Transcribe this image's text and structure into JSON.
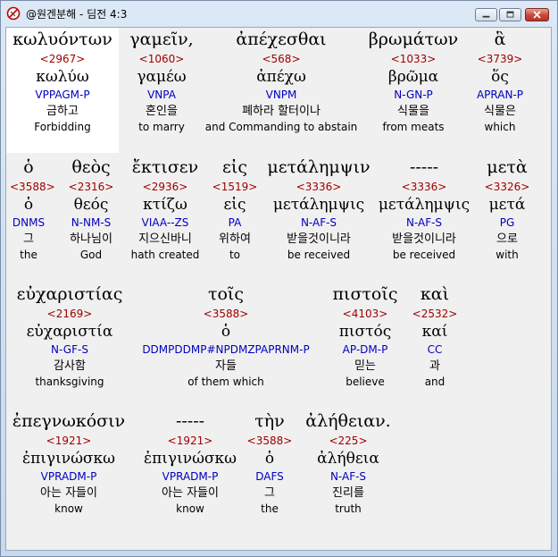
{
  "window": {
    "title": "@원겐분해 - 딤전 4:3",
    "minimize_label": "minimize",
    "maximize_label": "maximize",
    "close_label": "close"
  },
  "rows": [
    [
      {
        "word": "κωλυόντων",
        "strongs": "<2967>",
        "lemma": "κωλύω",
        "parse": "VPPAGM-P",
        "korean": "금하고",
        "english": "Forbidding",
        "selected": true
      },
      {
        "word": "γαμεῖν,",
        "strongs": "<1060>",
        "lemma": "γαμέω",
        "parse": "VNPA",
        "korean": "혼인을",
        "english": "to marry"
      },
      {
        "word": "ἀπέχεσθαι",
        "strongs": "<568>",
        "lemma": "ἀπέχω",
        "parse": "VNPM",
        "korean": "폐하라 할터이나",
        "english": "and Commanding to abstain"
      },
      {
        "word": "βρωμάτων",
        "strongs": "<1033>",
        "lemma": "βρῶμα",
        "parse": "N-GN-P",
        "korean": "식물을",
        "english": "from meats"
      },
      {
        "word": "ἃ",
        "strongs": "<3739>",
        "lemma": "ὅς",
        "parse": "APRAN-P",
        "korean": "식물은",
        "english": "which"
      }
    ],
    [
      {
        "word": "ὁ",
        "strongs": "<3588>",
        "lemma": "ὁ",
        "parse": "DNMS",
        "korean": "그",
        "english": "the"
      },
      {
        "word": "θεὸς",
        "strongs": "<2316>",
        "lemma": "θεός",
        "parse": "N-NM-S",
        "korean": "하나님이",
        "english": "God"
      },
      {
        "word": "ἔκτισεν",
        "strongs": "<2936>",
        "lemma": "κτίζω",
        "parse": "VIAA--ZS",
        "korean": "지으신바니",
        "english": "hath created"
      },
      {
        "word": "εἰς",
        "strongs": "<1519>",
        "lemma": "εἰς",
        "parse": "PA",
        "korean": "위하여",
        "english": "to"
      },
      {
        "word": "μετάλημψιν",
        "strongs": "<3336>",
        "lemma": "μετάλημψις",
        "parse": "N-AF-S",
        "korean": "받을것이니라",
        "english": "be received"
      },
      {
        "word": "-----",
        "strongs": "<3336>",
        "lemma": "μετάλημψις",
        "parse": "N-AF-S",
        "korean": "받을것이니라",
        "english": "be received"
      },
      {
        "word": "μετὰ",
        "strongs": "<3326>",
        "lemma": "μετά",
        "parse": "PG",
        "korean": "으로",
        "english": "with"
      }
    ],
    [
      {
        "word": "εὐχαριστίας",
        "strongs": "<2169>",
        "lemma": "εὐχαριστία",
        "parse": "N-GF-S",
        "korean": "감사함",
        "english": "thanksgiving"
      },
      {
        "word": "τοῖς",
        "strongs": "<3588>",
        "lemma": "ὁ",
        "parse": "DDMPDDMP#NPDMZPAPRNM-P",
        "korean": "자들",
        "english": "of them which"
      },
      {
        "word": "πιστοῖς",
        "strongs": "<4103>",
        "lemma": "πιστός",
        "parse": "AP-DM-P",
        "korean": "믿는",
        "english": "believe"
      },
      {
        "word": "καὶ",
        "strongs": "<2532>",
        "lemma": "καί",
        "parse": "CC",
        "korean": "과",
        "english": "and"
      }
    ],
    [
      {
        "word": "ἐπεγνωκόσιν",
        "strongs": "<1921>",
        "lemma": "ἐπιγινώσκω",
        "parse": "VPRADM-P",
        "korean": "아는 자들이",
        "english": "know"
      },
      {
        "word": "-----",
        "strongs": "<1921>",
        "lemma": "ἐπιγινώσκω",
        "parse": "VPRADM-P",
        "korean": "아는 자들이",
        "english": "know"
      },
      {
        "word": "τὴν",
        "strongs": "<3588>",
        "lemma": "ὁ",
        "parse": "DAFS",
        "korean": "그",
        "english": "the"
      },
      {
        "word": "ἀλήθειαν.",
        "strongs": "<225>",
        "lemma": "ἀλήθεια",
        "parse": "N-AF-S",
        "korean": "진리를",
        "english": "truth"
      }
    ]
  ]
}
